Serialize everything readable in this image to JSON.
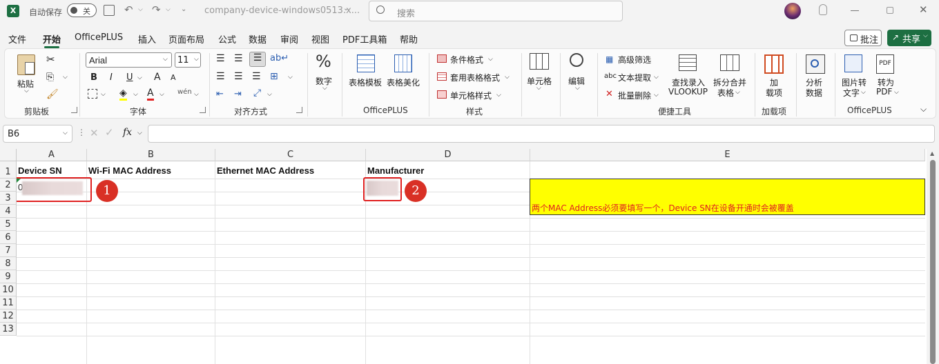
{
  "titlebar": {
    "autosave_label": "自动保存",
    "autosave_state": "关",
    "filename": "company-device-windows0513.x...",
    "search_placeholder": "搜索"
  },
  "menu": {
    "tabs": [
      "文件",
      "开始",
      "OfficePLUS",
      "插入",
      "页面布局",
      "公式",
      "数据",
      "审阅",
      "视图",
      "PDF工具箱",
      "帮助"
    ],
    "active_tab": "开始",
    "comment_btn": "批注",
    "share_btn": "共享"
  },
  "ribbon": {
    "clipboard": {
      "paste": "粘贴",
      "label": "剪贴板"
    },
    "font": {
      "name": "Arial",
      "size": "11",
      "bold": "B",
      "italic": "I",
      "underline": "U",
      "grow": "A",
      "shrink": "A",
      "fontcolor": "A",
      "label": "字体"
    },
    "alignment": {
      "label": "对齐方式"
    },
    "number": {
      "btn": "数字"
    },
    "officeplus1": {
      "template": "表格模板",
      "beautify": "表格美化",
      "label": "OfficePLUS"
    },
    "styles": {
      "cond": "条件格式",
      "table": "套用表格格式",
      "cell": "单元格样式",
      "label": "样式"
    },
    "cells": {
      "btn": "单元格"
    },
    "edit": {
      "btn": "编辑"
    },
    "tools": {
      "advfilter": "高级筛选",
      "textextract": "文本提取",
      "batchdel": "批量删除",
      "lookup1": "查找录入",
      "lookup2": "VLOOKUP",
      "split1": "拆分合并",
      "split2": "表格",
      "label": "便捷工具"
    },
    "addins": {
      "btn1": "加",
      "btn2": "载项",
      "label": "加载项"
    },
    "analyze": {
      "btn1": "分析",
      "btn2": "数据"
    },
    "officeplus2": {
      "pic1": "图片转",
      "pic2": "文字",
      "pdf1": "转为",
      "pdf2": "PDF",
      "label": "OfficePLUS"
    }
  },
  "formula": {
    "cell_ref": "B6",
    "fx": "fx",
    "content": ""
  },
  "sheet": {
    "columns": [
      "A",
      "B",
      "C",
      "D",
      "E"
    ],
    "rows": [
      "1",
      "2",
      "3",
      "4",
      "5",
      "6",
      "7",
      "8",
      "9",
      "10",
      "11",
      "12",
      "13"
    ],
    "headers": {
      "A1": "Device SN",
      "B1": "Wi-Fi MAC Address",
      "C1": "Ethernet MAC Address",
      "D1": "Manufacturer"
    },
    "a2_prefix": "0",
    "note": "两个MAC Address必须要填写一个，Device SN在设备开通时会被覆盖",
    "note_color": "#e02020",
    "note_bg": "#ffff00",
    "badge1": "1",
    "badge2": "2"
  }
}
